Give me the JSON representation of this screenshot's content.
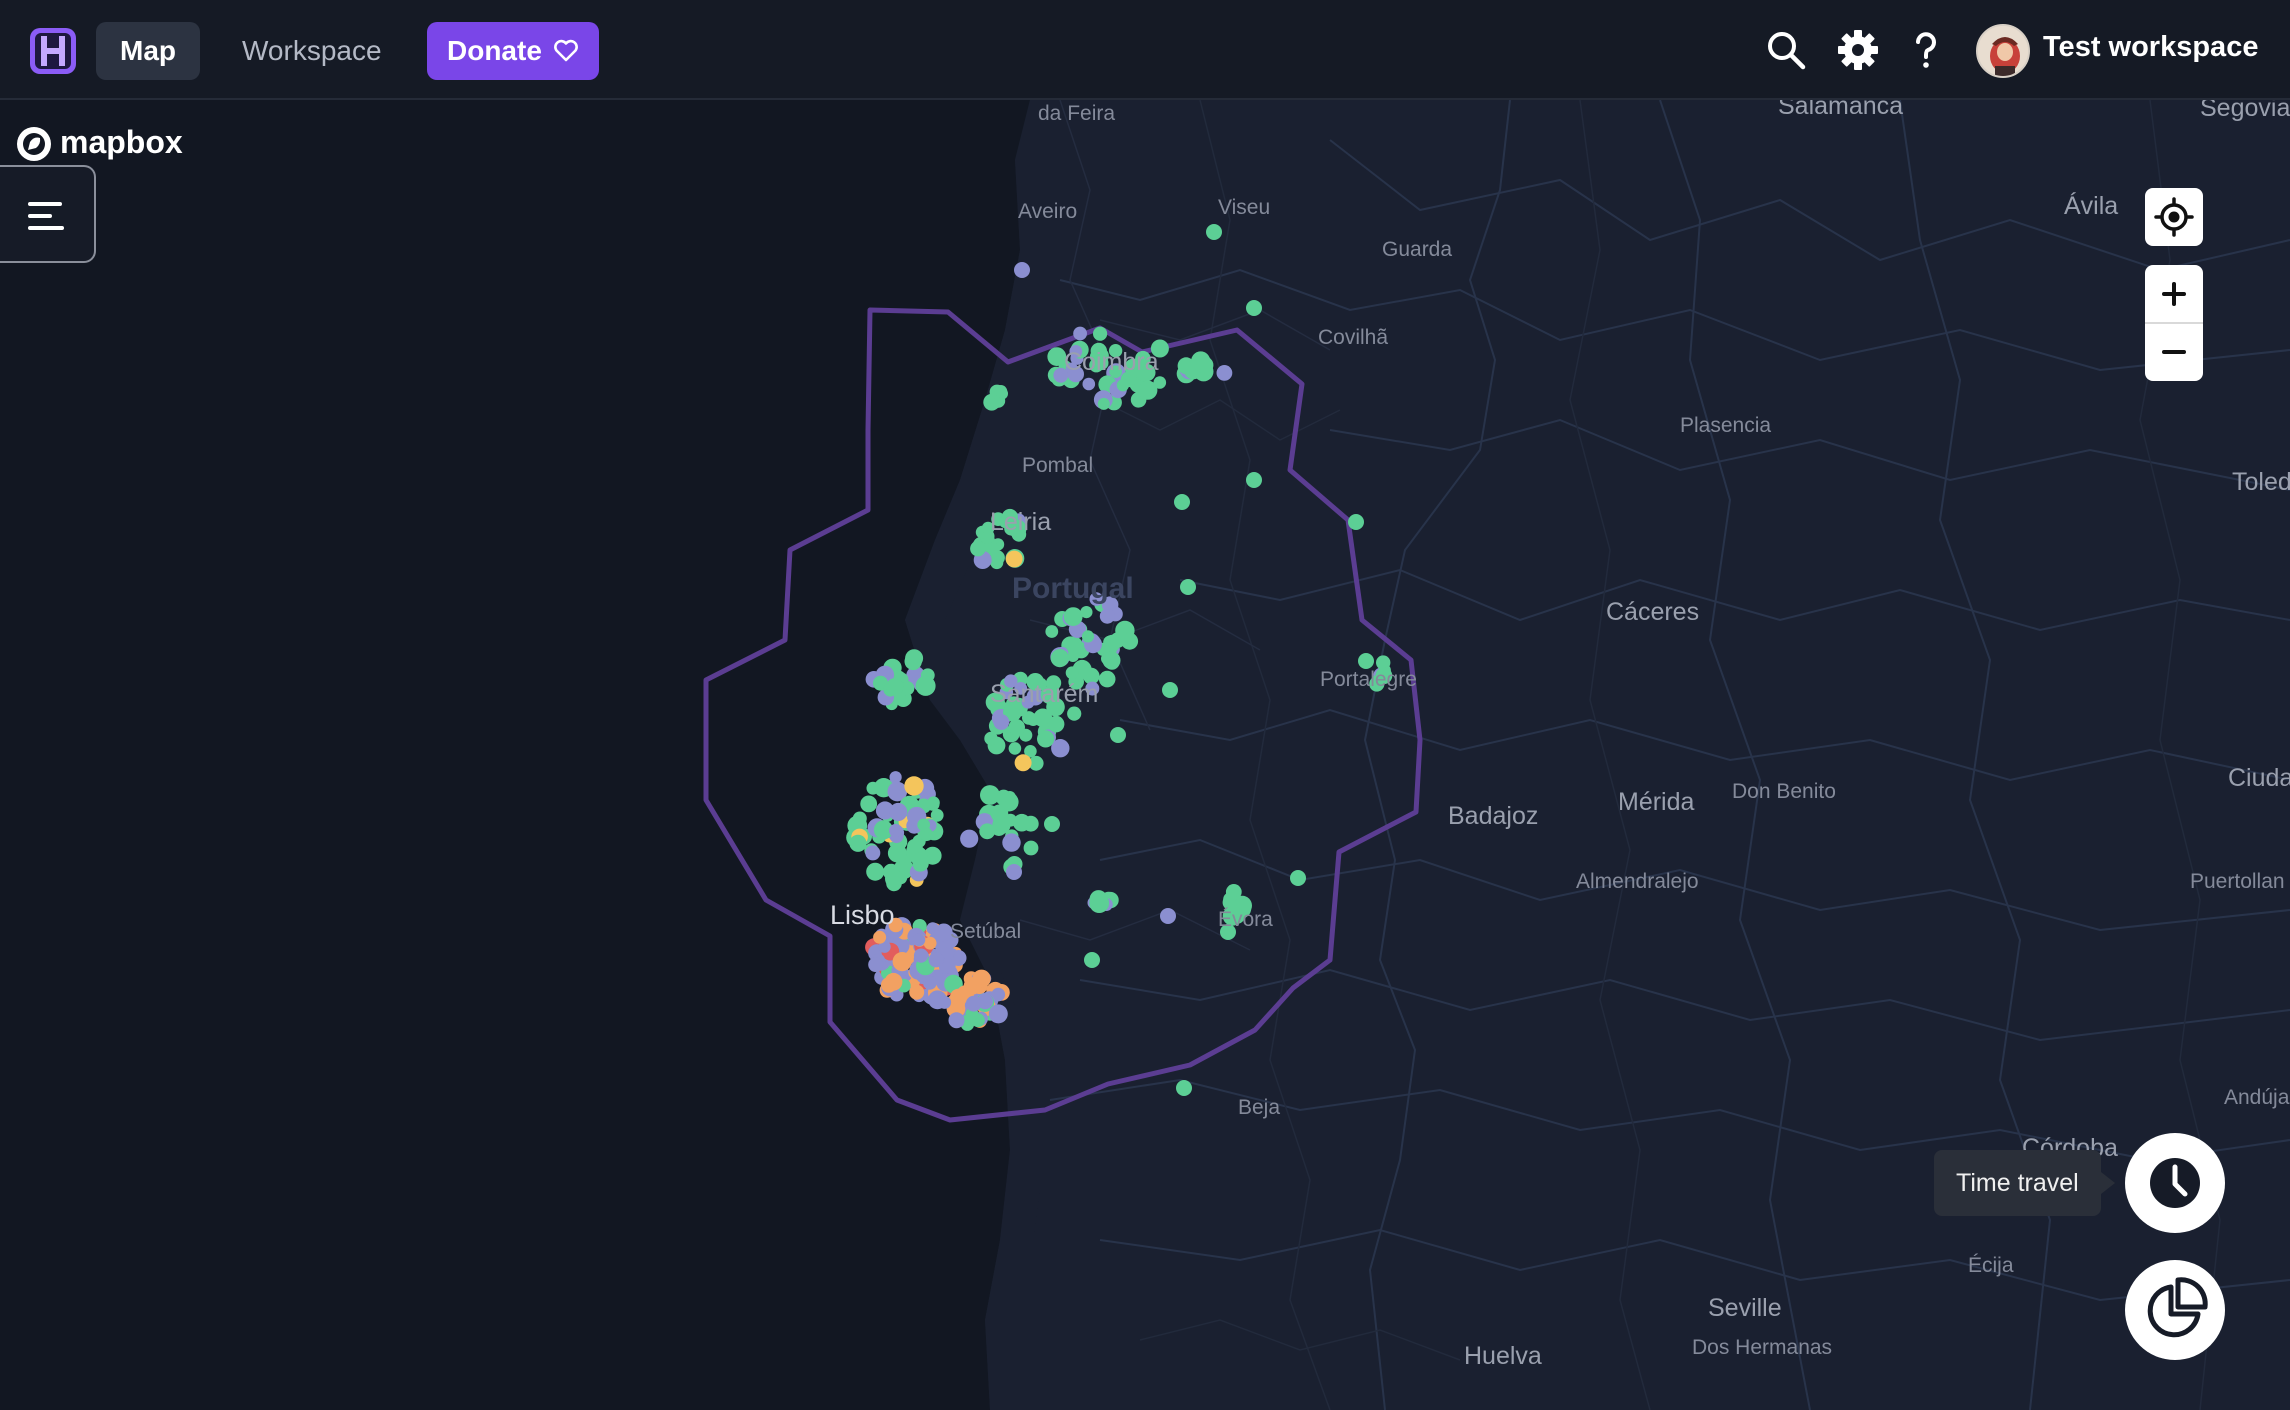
{
  "nav": {
    "logo_icon": "workspace-logo-icon",
    "map_label": "Map",
    "workspace_label": "Workspace",
    "donate_label": "Donate",
    "donate_icon": "heart-icon"
  },
  "header_actions": {
    "search_icon": "search-icon",
    "settings_icon": "gear-icon",
    "help_icon": "help-icon",
    "workspace_name": "Test workspace"
  },
  "map": {
    "attribution_logo": "mapbox",
    "accent_color": "#7a46e8",
    "background_color": "#121722",
    "land_color": "#1a2030",
    "region_outline_color": "#5b3d92",
    "marker_colors": [
      "#5ccf95",
      "#8b8fd0",
      "#f4c55c",
      "#f2a162",
      "#e25d5d"
    ],
    "labels": {
      "da_feira": "da Feira",
      "salamanca": "Salamanca",
      "segovia": "Segovia",
      "aveiro": "Aveiro",
      "viseu": "Viseu",
      "guarda": "Guarda",
      "avila": "Ávila",
      "coimbra": "Coimbra",
      "covilha": "Covilhã",
      "plasencia": "Plasencia",
      "pombal": "Pombal",
      "toledo": "Toled",
      "leiria": "Leiria",
      "portugal": "Portugal",
      "caceres": "Cáceres",
      "portalegre": "Portalegre",
      "santarem": "Santarém",
      "badajoz": "Badajoz",
      "merida": "Mérida",
      "don_benito": "Don Benito",
      "ciudad": "Ciuda",
      "almendralejo": "Almendralejo",
      "puertollano": "Puertollan",
      "lisboa": "Lisbo",
      "setubal": "Setúbal",
      "evora": "Évora",
      "beja": "Beja",
      "andujar": "Andúja",
      "cordoba": "Córdoba",
      "ecija": "Écija",
      "seville": "Seville",
      "dos_hermanas": "Dos Hermanas",
      "huelva": "Huelva"
    }
  },
  "controls": {
    "menu_icon": "menu-icon",
    "locate_icon": "locate-icon",
    "zoom_in_icon": "plus-icon",
    "zoom_out_icon": "minus-icon",
    "time_travel_icon": "clock-icon",
    "time_travel_tooltip": "Time travel",
    "stats_icon": "pie-chart-icon"
  }
}
